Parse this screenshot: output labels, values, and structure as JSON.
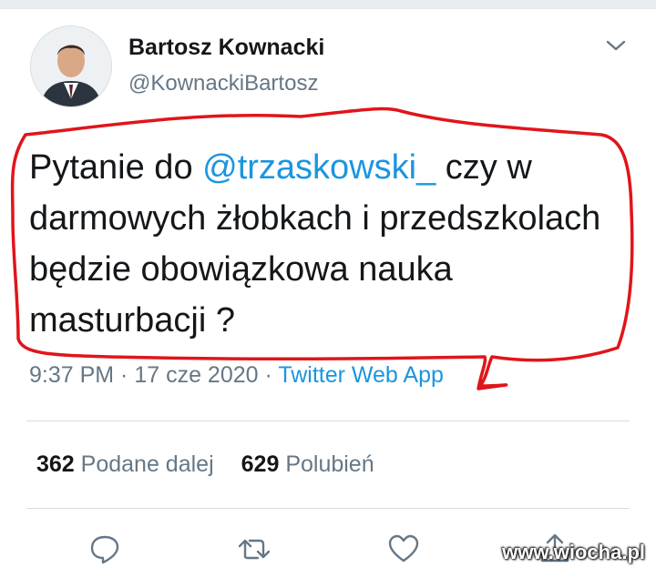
{
  "author": {
    "display_name": "Bartosz Kownacki",
    "handle": "@KownackiBartosz"
  },
  "tweet": {
    "text_before": "Pytanie do ",
    "mention": "@trzaskowski_",
    "text_after": "  czy w darmowych żłobkach i przedszkolach będzie obowiązkowa nauka masturbacji ?",
    "time": "9:37 PM",
    "separator": " · ",
    "date": "17 cze 2020",
    "source": "Twitter Web App"
  },
  "stats": {
    "retweets_count": "362",
    "retweets_label": "Podane dalej",
    "likes_count": "629",
    "likes_label": "Polubień"
  },
  "icons": {
    "menu": "chevron-down-icon",
    "reply": "reply-icon",
    "retweet": "retweet-icon",
    "like": "heart-icon",
    "share": "share-icon"
  },
  "colors": {
    "accent": "#1b95e0",
    "secondary_text": "#657786",
    "highlight_marker": "#e0151b"
  },
  "watermark": "www.wiocha.pl"
}
